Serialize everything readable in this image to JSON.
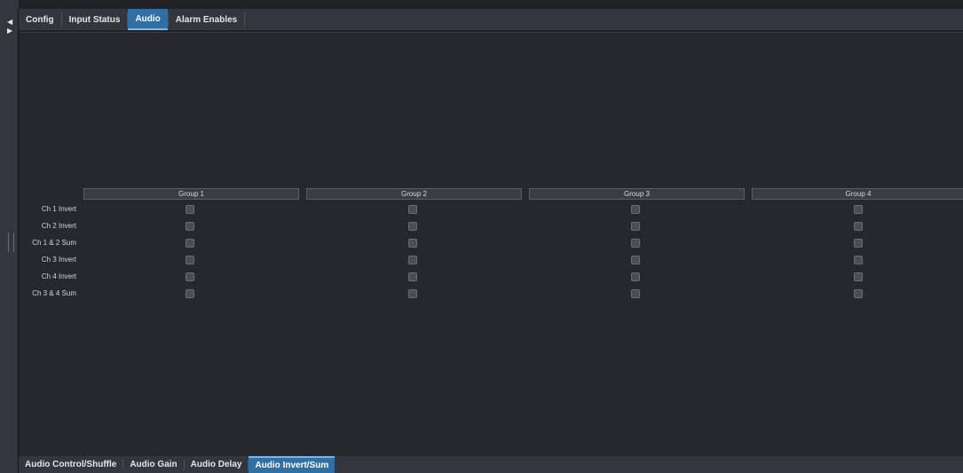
{
  "top_tabs": [
    {
      "label": "Config",
      "active": false
    },
    {
      "label": "Input Status",
      "active": false
    },
    {
      "label": "Audio",
      "active": true
    },
    {
      "label": "Alarm Enables",
      "active": false
    }
  ],
  "groups": [
    {
      "label": "Group 1"
    },
    {
      "label": "Group 2"
    },
    {
      "label": "Group 3"
    },
    {
      "label": "Group 4"
    }
  ],
  "rows": [
    {
      "label": "Ch 1 Invert"
    },
    {
      "label": "Ch 2 Invert"
    },
    {
      "label": "Ch 1 & 2 Sum"
    },
    {
      "label": "Ch 3 Invert"
    },
    {
      "label": "Ch 4 Invert"
    },
    {
      "label": "Ch 3 & 4 Sum"
    }
  ],
  "checkbox_checked": false,
  "bottom_tabs": [
    {
      "label": "Audio Control/Shuffle",
      "active": false
    },
    {
      "label": "Audio Gain",
      "active": false
    },
    {
      "label": "Audio Delay",
      "active": false
    },
    {
      "label": "Audio Invert/Sum",
      "active": true
    }
  ],
  "colors": {
    "background": "#1f2125",
    "panel": "#26282d",
    "accent": "#2f6fa6"
  }
}
